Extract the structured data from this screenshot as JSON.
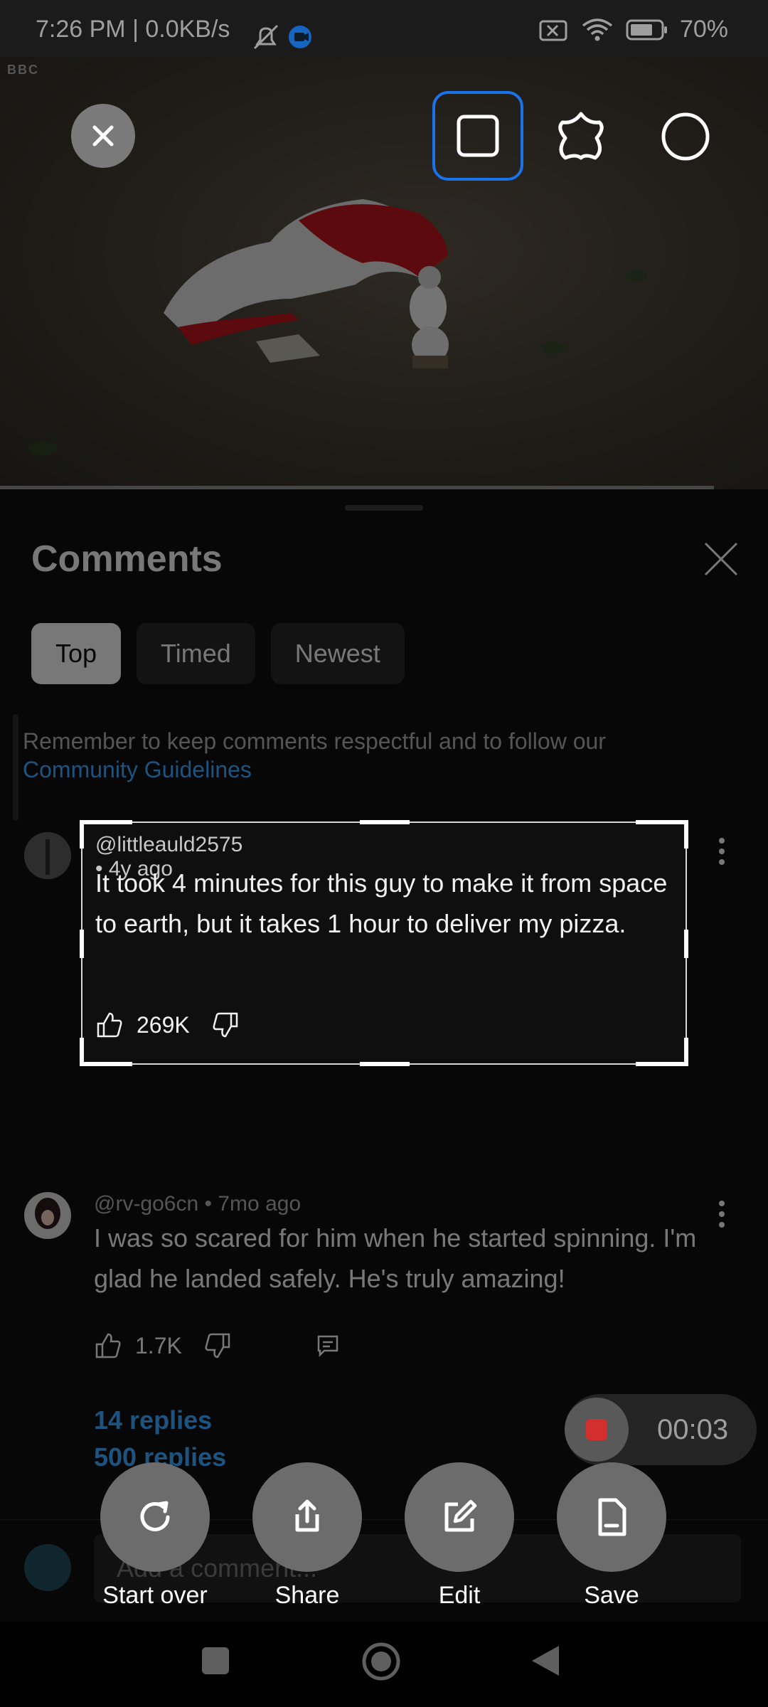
{
  "status_bar": {
    "time_net": "7:26 PM | 0.0KB/s",
    "battery": "70%"
  },
  "video": {
    "watermark": "BBC",
    "progress_fraction": 0.93
  },
  "comments_panel": {
    "title": "Comments",
    "tabs": [
      {
        "label": "Top",
        "active": true
      },
      {
        "label": "Timed",
        "active": false
      },
      {
        "label": "Newest",
        "active": false
      }
    ],
    "guidelines_text": "Remember to keep comments respectful and to follow our",
    "guidelines_link": "Community Guidelines",
    "comments": [
      {
        "author": "@littleauld2575",
        "age": "4y ago",
        "text": "It took 4 minutes for this guy to make it from space to earth, but it takes 1 hour to deliver my pizza.",
        "likes": "269K",
        "replies": "500 replies"
      },
      {
        "author": "@rv-go6cn",
        "age": "7mo ago",
        "text": "I was so scared for him when he started spinning. I'm glad he landed safely. He's truly amazing!",
        "likes": "1.7K",
        "replies": "14 replies"
      }
    ],
    "composer_placeholder": "Add a comment..."
  },
  "screenshot_tool": {
    "shapes": [
      "rectangle-shape-icon",
      "freeform-shape-icon",
      "circle-shape-icon"
    ],
    "selected_shape": "rectangle-shape-icon",
    "recording_time": "00:03",
    "actions": [
      {
        "label": "Start over",
        "icon": "refresh-icon"
      },
      {
        "label": "Share",
        "icon": "share-icon"
      },
      {
        "label": "Edit",
        "icon": "edit-icon"
      },
      {
        "label": "Save",
        "icon": "save-icon"
      }
    ]
  },
  "colors": {
    "accent": "#1a73e8",
    "link": "#3ea6ff",
    "record": "#d32f2f"
  }
}
